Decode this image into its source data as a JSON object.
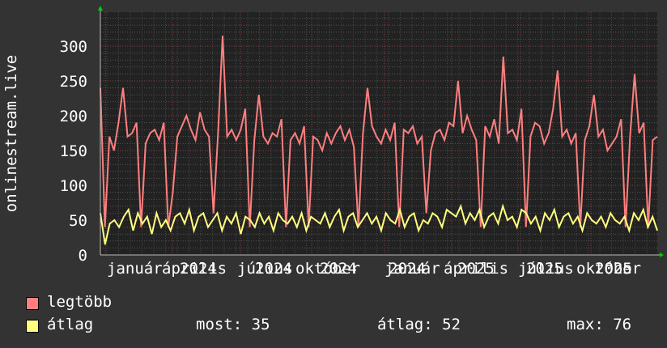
{
  "chart_data": {
    "type": "line",
    "ylabel": "onlinestream.live",
    "ylim": [
      0,
      340
    ],
    "yticks": [
      "0",
      "50",
      "100",
      "150",
      "200",
      "250",
      "300"
    ],
    "x_month_labels": [
      "január",
      "április",
      "július",
      "október",
      "január",
      "április",
      "július",
      "október"
    ],
    "x_year_labels": [
      "2024",
      "2024",
      "2024",
      "2024",
      "2025",
      "2025",
      "2025",
      "2025"
    ],
    "grid": true,
    "series": [
      {
        "name": "legtöbb",
        "color": "#ff7f7f",
        "values": [
          240,
          40,
          170,
          150,
          190,
          240,
          170,
          175,
          190,
          40,
          160,
          175,
          180,
          165,
          190,
          40,
          90,
          170,
          185,
          200,
          180,
          165,
          205,
          180,
          170,
          60,
          175,
          315,
          170,
          180,
          165,
          180,
          210,
          40,
          165,
          230,
          170,
          160,
          175,
          170,
          195,
          40,
          165,
          175,
          160,
          185,
          40,
          170,
          165,
          150,
          175,
          160,
          175,
          185,
          165,
          180,
          155,
          40,
          175,
          240,
          185,
          170,
          160,
          180,
          165,
          190,
          40,
          180,
          175,
          185,
          160,
          170,
          60,
          150,
          175,
          180,
          165,
          190,
          185,
          250,
          175,
          200,
          180,
          165,
          40,
          185,
          170,
          195,
          160,
          285,
          175,
          180,
          165,
          210,
          40,
          170,
          190,
          185,
          160,
          175,
          210,
          265,
          170,
          180,
          160,
          175,
          40,
          165,
          185,
          230,
          170,
          180,
          150,
          160,
          170,
          195,
          40,
          170,
          260,
          175,
          190,
          40,
          165,
          170
        ]
      },
      {
        "name": "átlag",
        "color": "#ffff7f",
        "values": [
          60,
          15,
          45,
          50,
          40,
          55,
          65,
          35,
          60,
          45,
          55,
          30,
          60,
          40,
          50,
          35,
          55,
          60,
          45,
          65,
          35,
          55,
          60,
          40,
          50,
          60,
          35,
          55,
          45,
          60,
          30,
          55,
          50,
          40,
          60,
          45,
          55,
          35,
          60,
          50,
          45,
          55,
          40,
          60,
          35,
          55,
          50,
          45,
          60,
          40,
          55,
          65,
          35,
          55,
          60,
          40,
          50,
          60,
          45,
          55,
          35,
          60,
          50,
          45,
          65,
          40,
          55,
          60,
          35,
          50,
          45,
          60,
          55,
          40,
          65,
          60,
          55,
          70,
          45,
          60,
          50,
          65,
          40,
          55,
          60,
          45,
          70,
          50,
          55,
          40,
          65,
          60,
          45,
          55,
          35,
          60,
          50,
          65,
          40,
          55,
          60,
          45,
          55,
          35,
          60,
          50,
          45,
          55,
          40,
          60,
          50,
          45,
          55,
          35,
          60,
          50,
          65,
          40,
          55,
          35
        ]
      }
    ]
  },
  "legend": {
    "items": [
      "legtöbb",
      "átlag"
    ],
    "now_label": "most: 35",
    "avg_label": "átlag: 52",
    "max_label": "max: 76"
  }
}
